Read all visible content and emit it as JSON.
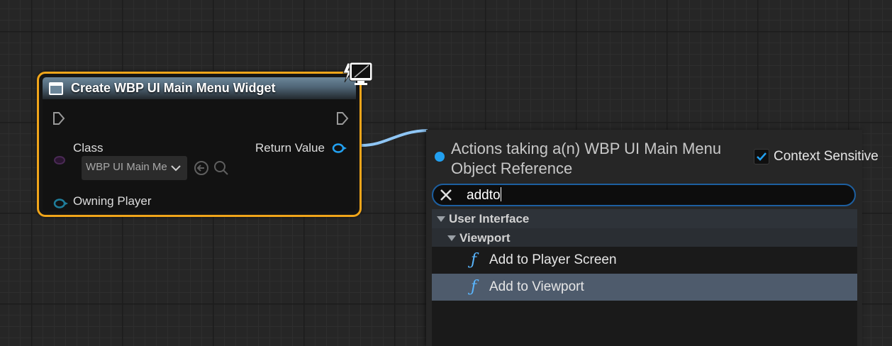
{
  "node": {
    "title": "Create WBP UI Main Menu Widget",
    "class_label": "Class",
    "class_value": "WBP UI Main Menu",
    "return_label": "Return Value",
    "owning_label": "Owning Player",
    "icons": [
      "widget-icon",
      "monitor-icon",
      "exec-in-icon",
      "exec-out-icon",
      "arrow-left-icon",
      "search-icon",
      "chevron-down-icon"
    ]
  },
  "panel": {
    "title": "Actions taking a(n) WBP UI Main Menu Object Reference",
    "context_label": "Context Sensitive",
    "context_checked": true,
    "search_value": "addto",
    "category": "User Interface",
    "subcategory": "Viewport",
    "items": [
      {
        "label": "Add to Player Screen",
        "selected": false
      },
      {
        "label": "Add to Viewport",
        "selected": true
      }
    ]
  },
  "colors": {
    "node_border": "#f0a51a",
    "accent": "#22a0f0",
    "wire": "#8fc6f5",
    "selected_row": "#4e5b6c"
  }
}
